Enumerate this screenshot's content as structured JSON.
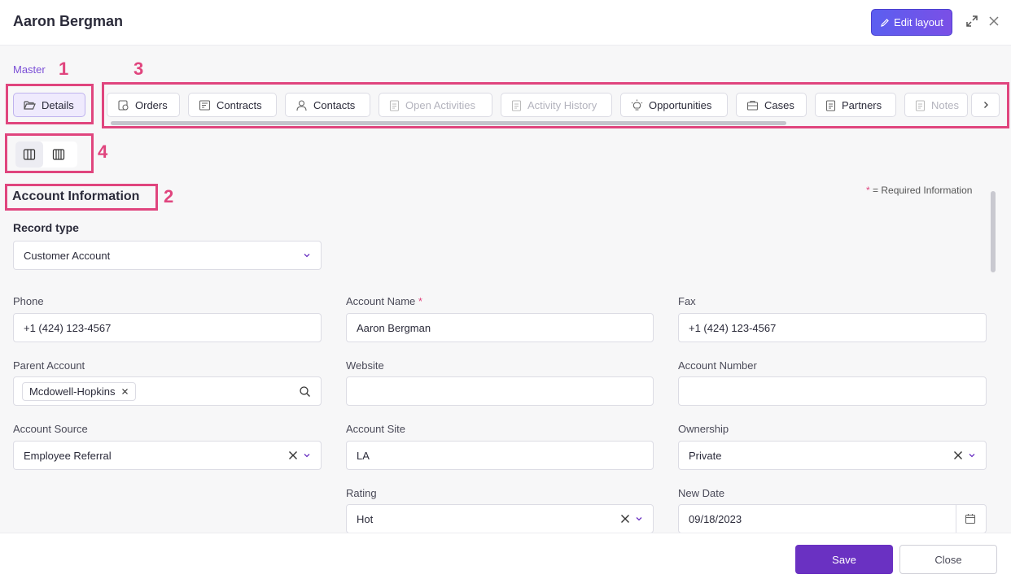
{
  "header": {
    "title": "Aaron Bergman",
    "edit_layout_label": "Edit layout"
  },
  "breadcrumb": {
    "master": "Master"
  },
  "annotations": {
    "a1": "1",
    "a2": "2",
    "a3": "3",
    "a4": "4"
  },
  "tabs": [
    {
      "label": "Details",
      "icon": "folder-open-icon",
      "state": "active"
    },
    {
      "label": "Orders",
      "icon": "orders-icon",
      "state": "normal"
    },
    {
      "label": "Contracts",
      "icon": "contract-icon",
      "state": "normal"
    },
    {
      "label": "Contacts",
      "icon": "user-icon",
      "state": "normal"
    },
    {
      "label": "Open Activities",
      "icon": "clipboard-icon",
      "state": "disabled"
    },
    {
      "label": "Activity History",
      "icon": "clipboard-icon",
      "state": "disabled"
    },
    {
      "label": "Opportunities",
      "icon": "lightbulb-icon",
      "state": "normal"
    },
    {
      "label": "Cases",
      "icon": "briefcase-icon",
      "state": "normal"
    },
    {
      "label": "Partners",
      "icon": "clipboard-icon",
      "state": "normal"
    },
    {
      "label": "Notes",
      "icon": "clipboard-icon",
      "state": "disabled"
    }
  ],
  "section": {
    "title": "Account Information",
    "required_star": "*",
    "required_note": "= Required Information"
  },
  "form": {
    "record_type": {
      "label": "Record type",
      "value": "Customer Account"
    },
    "phone": {
      "label": "Phone",
      "value": "+1 (424) 123-4567"
    },
    "account_name": {
      "label": "Account Name",
      "required": "*",
      "value": "Aaron Bergman"
    },
    "fax": {
      "label": "Fax",
      "value": "+1 (424) 123-4567"
    },
    "parent_account": {
      "label": "Parent Account",
      "chip": "Mcdowell-Hopkins"
    },
    "website": {
      "label": "Website",
      "value": ""
    },
    "account_number": {
      "label": "Account Number",
      "value": ""
    },
    "account_source": {
      "label": "Account Source",
      "value": "Employee Referral"
    },
    "account_site": {
      "label": "Account Site",
      "value": "LA"
    },
    "ownership": {
      "label": "Ownership",
      "value": "Private"
    },
    "rating": {
      "label": "Rating",
      "value": "Hot"
    },
    "new_date": {
      "label": "New Date",
      "value": "09/18/2023"
    }
  },
  "footer": {
    "save_label": "Save",
    "close_label": "Close"
  },
  "colors": {
    "accent": "#6a31c2",
    "highlight": "#e0457e",
    "edit_button": "#5b5ff0"
  }
}
